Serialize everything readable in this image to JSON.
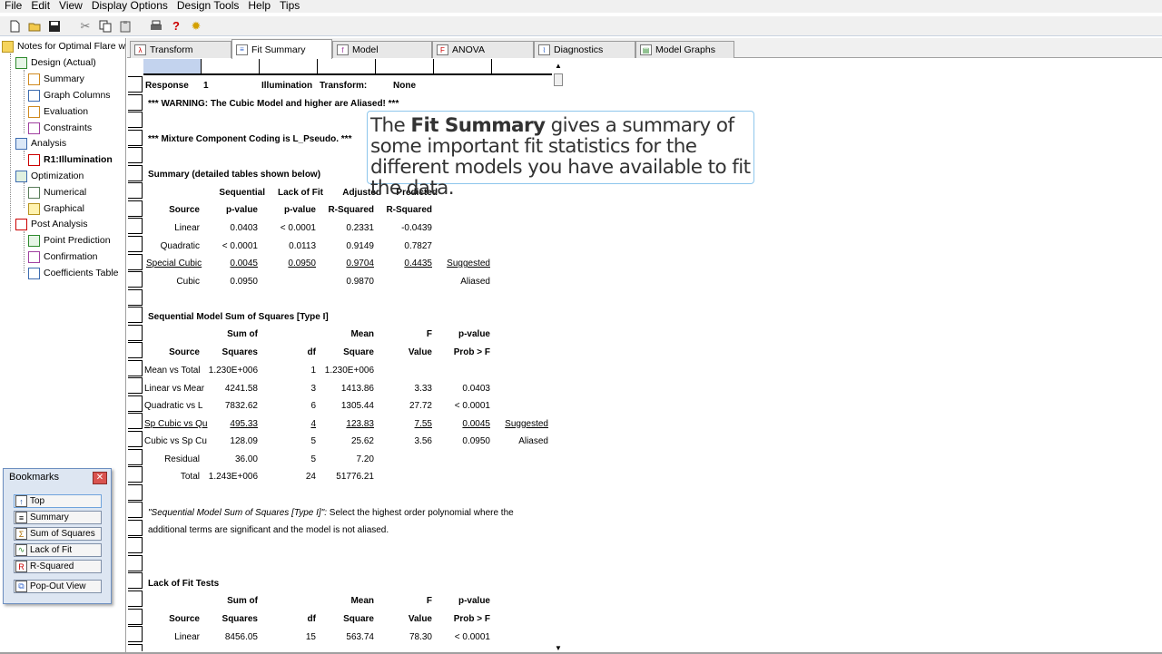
{
  "menu": [
    "File",
    "Edit",
    "View",
    "Display Options",
    "Design Tools",
    "Help",
    "Tips"
  ],
  "tree": {
    "root": "Notes for Optimal Flare wit",
    "design": "Design (Actual)",
    "summary": "Summary",
    "graph_columns": "Graph Columns",
    "evaluation": "Evaluation",
    "constraints": "Constraints",
    "analysis": "Analysis",
    "r1": "R1:Illumination",
    "optimization": "Optimization",
    "numerical": "Numerical",
    "graphical": "Graphical",
    "post_analysis": "Post Analysis",
    "point_prediction": "Point Prediction",
    "confirmation": "Confirmation",
    "coefficients_table": "Coefficients Table"
  },
  "tabs": [
    "Transform",
    "Fit Summary",
    "Model",
    "ANOVA",
    "Diagnostics",
    "Model Graphs"
  ],
  "report": {
    "response_label": "Response",
    "response_num": "1",
    "response_name": "Illumination",
    "transform_label": "Transform:",
    "transform_val": "None",
    "warning": "*** WARNING:  The Cubic Model and higher are Aliased! ***",
    "coding": "*** Mixture Component Coding is L_Pseudo. ***",
    "summary_title": "Summary (detailed tables shown below)",
    "sum_hdr1": [
      "Sequential",
      "Lack of Fit",
      "Adjusted",
      "Predicted"
    ],
    "sum_hdr2": [
      "Source",
      "p-value",
      "p-value",
      "R-Squared",
      "R-Squared"
    ],
    "sum_rows": [
      [
        "Linear",
        "0.0403",
        "< 0.0001",
        "0.2331",
        "-0.0439",
        ""
      ],
      [
        "Quadratic",
        "< 0.0001",
        "0.0113",
        "0.9149",
        "0.7827",
        ""
      ],
      [
        "Special Cubic",
        "0.0045",
        "0.0950",
        "0.9704",
        "0.4435",
        "Suggested"
      ],
      [
        "Cubic",
        "0.0950",
        "",
        "0.9870",
        "",
        "Aliased"
      ]
    ],
    "seq_title": "Sequential Model Sum of Squares [Type I]",
    "seq_hdr1": [
      "Sum of",
      "Mean",
      "F",
      "p-value"
    ],
    "seq_hdr2": [
      "Source",
      "Squares",
      "df",
      "Square",
      "Value",
      "Prob > F"
    ],
    "seq_rows": [
      [
        "Mean vs Total",
        "1.230E+006",
        "1",
        "1.230E+006",
        "",
        "",
        ""
      ],
      [
        "Linear vs Mear",
        "4241.58",
        "3",
        "1413.86",
        "3.33",
        "0.0403",
        ""
      ],
      [
        "Quadratic vs L",
        "7832.62",
        "6",
        "1305.44",
        "27.72",
        "< 0.0001",
        ""
      ],
      [
        "Sp Cubic vs Qu",
        "495.33",
        "4",
        "123.83",
        "7.55",
        "0.0045",
        "Suggested"
      ],
      [
        "Cubic vs Sp Cu",
        "128.09",
        "5",
        "25.62",
        "3.56",
        "0.0950",
        "Aliased"
      ],
      [
        "Residual",
        "36.00",
        "5",
        "7.20",
        "",
        "",
        ""
      ],
      [
        "Total",
        "1.243E+006",
        "24",
        "51776.21",
        "",
        "",
        ""
      ]
    ],
    "note_italic": "\"Sequential Model Sum of Squares [Type I]\":",
    "note_rest": "  Select the highest order polynomial where the",
    "note2": "additional terms are significant and the model is not aliased.",
    "lof_title": "Lack of Fit Tests",
    "lof_hdr1": [
      "Sum of",
      "Mean",
      "F",
      "p-value"
    ],
    "lof_hdr2": [
      "Source",
      "Squares",
      "df",
      "Square",
      "Value",
      "Prob > F"
    ],
    "lof_rows": [
      [
        "Linear",
        "8456.05",
        "15",
        "563.74",
        "78.30",
        "< 0.0001"
      ]
    ]
  },
  "callout": {
    "pre": "The ",
    "bold": "Fit Summary",
    "rest": " gives a summary of some important fit statistics for the different models you have available to fit the data."
  },
  "bookmarks": {
    "title": "Bookmarks",
    "items": [
      "Top",
      "Summary",
      "Sum of Squares",
      "Lack of Fit",
      "R-Squared",
      "Pop-Out View"
    ]
  }
}
